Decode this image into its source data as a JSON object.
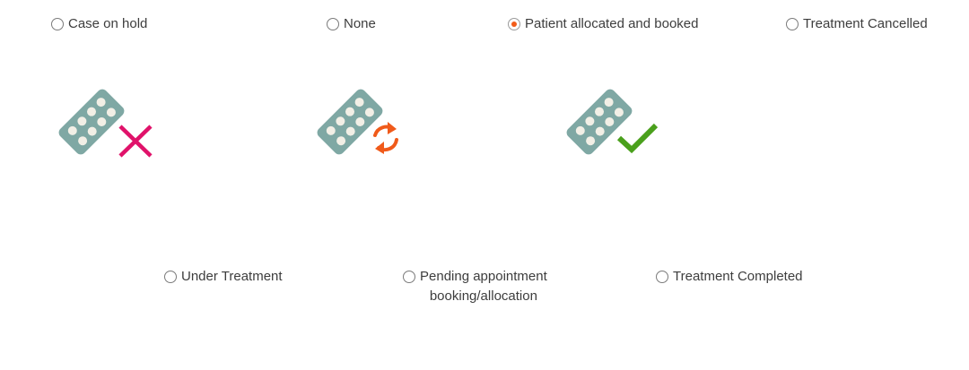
{
  "options": [
    {
      "label": "Case on hold",
      "selected": false
    },
    {
      "label": "None",
      "selected": false
    },
    {
      "label": "Patient allocated and booked",
      "selected": true
    },
    {
      "label": "Treatment Cancelled",
      "selected": false
    },
    {
      "label": "Under Treatment",
      "selected": false
    },
    {
      "label_line1": "Pending appointment",
      "label_line2": "booking/allocation",
      "selected": false
    },
    {
      "label": "Treatment Completed",
      "selected": false
    }
  ],
  "colors": {
    "radio_selected": "#f25c19",
    "pill_pack": "#7fa8a4",
    "cross": "#e0126a",
    "refresh": "#f05a1a",
    "check": "#4aa01c"
  },
  "icons": [
    "pill-pack-cross-icon",
    "pill-pack-refresh-icon",
    "pill-pack-check-icon"
  ]
}
